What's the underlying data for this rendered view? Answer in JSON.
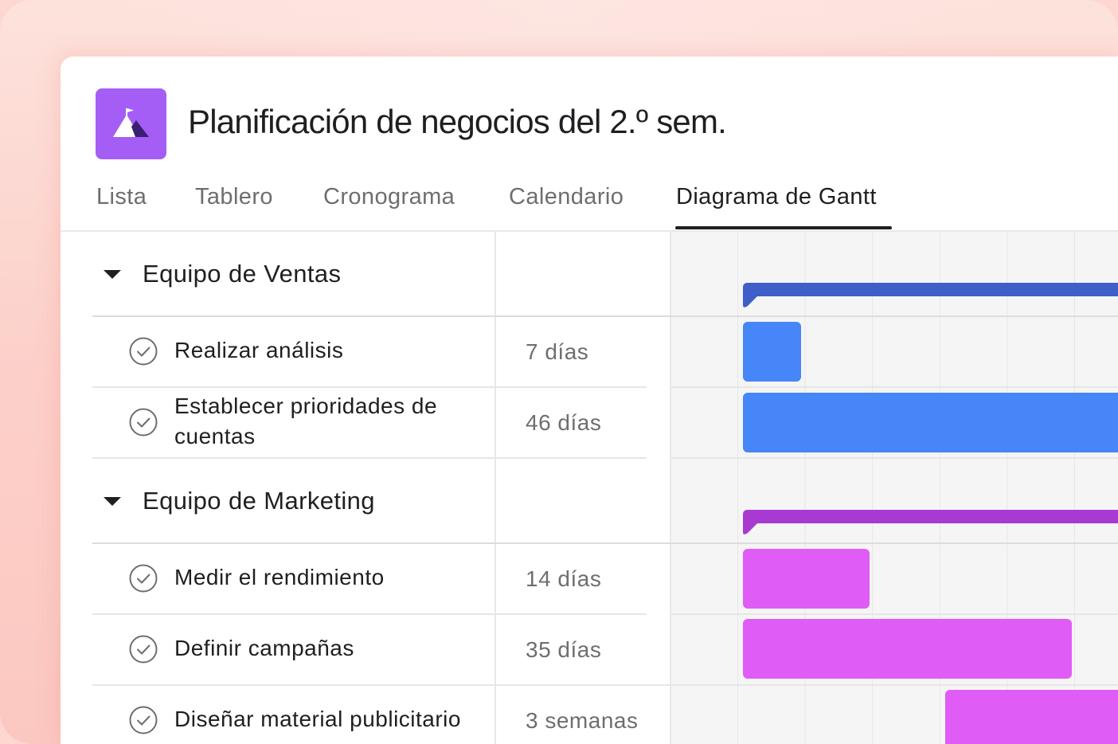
{
  "project": {
    "title": "Planificación de negocios del 2.º sem.",
    "icon": "mountain-flag-icon",
    "icon_color": "#a55ef5"
  },
  "tabs": [
    {
      "label": "Lista",
      "active": false
    },
    {
      "label": "Tablero",
      "active": false
    },
    {
      "label": "Cronograma",
      "active": false
    },
    {
      "label": "Calendario",
      "active": false
    },
    {
      "label": "Diagrama de Gantt",
      "active": true
    }
  ],
  "sections": [
    {
      "title": "Equipo de Ventas",
      "color": "#3e5fc8",
      "tasks": [
        {
          "name": "Realizar análisis",
          "duration": "7 días",
          "color": "#4686f8"
        },
        {
          "name": "Establecer prioridades de cuentas",
          "duration": "46 días",
          "color": "#4686f8"
        }
      ]
    },
    {
      "title": "Equipo de Marketing",
      "color": "#a93ad1",
      "tasks": [
        {
          "name": "Medir el rendimiento",
          "duration": "14 días",
          "color": "#e05cf7"
        },
        {
          "name": "Definir campañas",
          "duration": "35 días",
          "color": "#e05cf7"
        },
        {
          "name": "Diseñar material publicitario",
          "duration": "3 semanas",
          "color": "#e05cf7"
        }
      ]
    }
  ],
  "colors": {
    "page_background": "#fdd7d0",
    "grid_background": "#f5f5f5",
    "text_primary": "#1e1f21",
    "text_secondary": "#6d6e6f"
  }
}
